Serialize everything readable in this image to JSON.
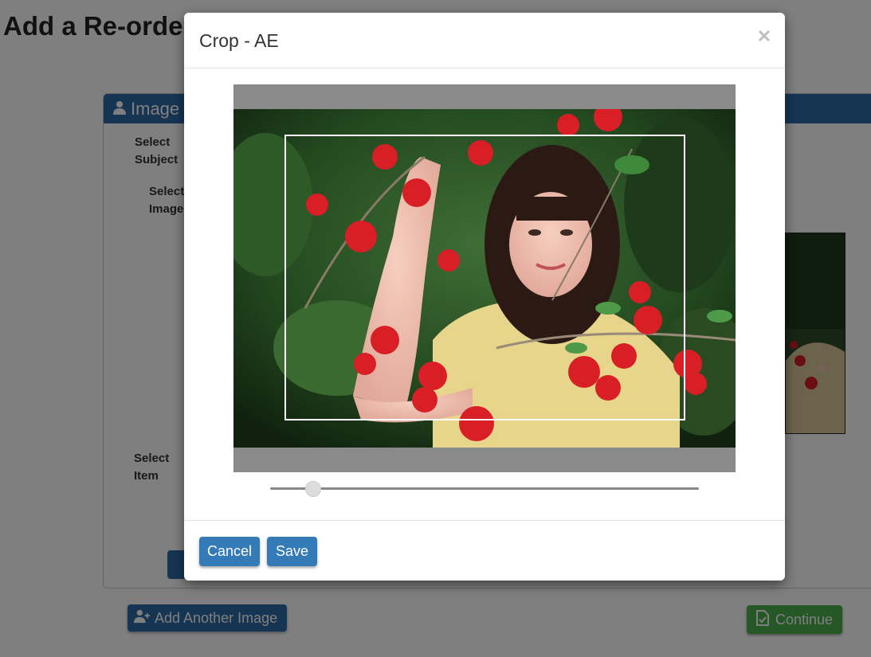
{
  "page": {
    "title": "Add a Re-order"
  },
  "panel": {
    "heading": "Image",
    "select_subject_label": [
      "Select",
      "Subject"
    ],
    "select_image_label": [
      "Select",
      "Image"
    ],
    "select_item_label": [
      "Select",
      "Item"
    ]
  },
  "actions": {
    "add_another_image_label": "Add Another Image",
    "continue_label": "Continue"
  },
  "modal": {
    "title": "Crop - AE",
    "cancel_label": "Cancel",
    "save_label": "Save",
    "zoom_level": 0.1
  },
  "colors": {
    "primary": "#337ab7",
    "panel_heading": "#2d6aa6",
    "success": "#4cae4c",
    "crop_background": "#8a8a8a"
  },
  "icons": {
    "panel_heading": "user-icon",
    "add_image": "user-plus-icon",
    "continue": "file-check-icon",
    "close": "close-icon"
  }
}
